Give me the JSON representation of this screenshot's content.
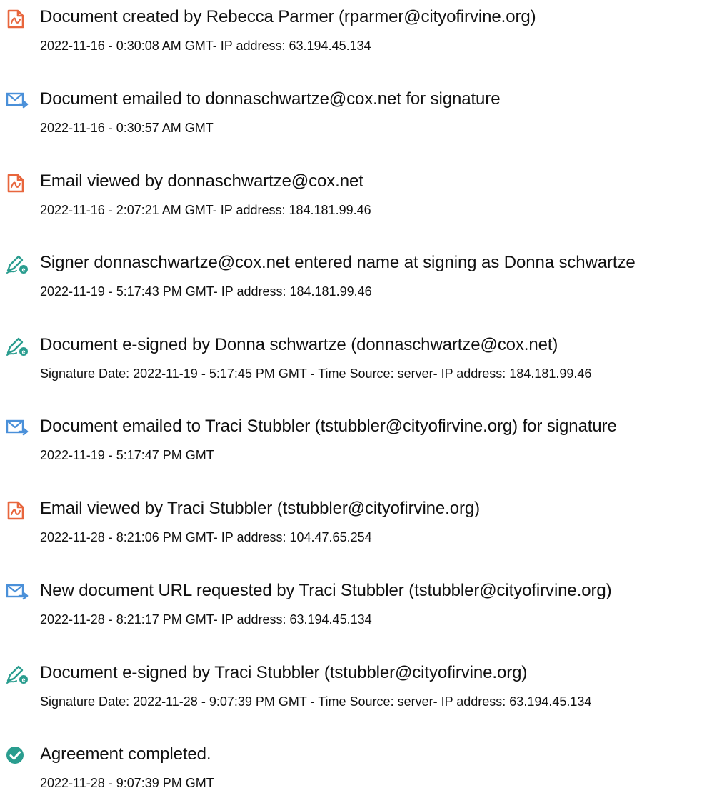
{
  "colors": {
    "doc_icon": "#e8663d",
    "mail_icon": "#4a90d9",
    "sign_icon": "#2a9d8f",
    "check_icon": "#2a9d8f"
  },
  "events": [
    {
      "icon": "document-icon",
      "title": "Document created by Rebecca Parmer (rparmer@cityofirvine.org)",
      "detail": "2022-11-16 - 0:30:08 AM GMT- IP address: 63.194.45.134"
    },
    {
      "icon": "email-icon",
      "title": "Document emailed to donnaschwartze@cox.net for signature",
      "detail": "2022-11-16 - 0:30:57 AM GMT"
    },
    {
      "icon": "document-icon",
      "title": "Email viewed by donnaschwartze@cox.net",
      "detail": "2022-11-16 - 2:07:21 AM GMT- IP address: 184.181.99.46"
    },
    {
      "icon": "esign-icon",
      "title": "Signer donnaschwartze@cox.net entered name at signing as Donna schwartze",
      "detail": "2022-11-19 - 5:17:43 PM GMT- IP address: 184.181.99.46"
    },
    {
      "icon": "esign-icon",
      "title": "Document e-signed by Donna schwartze (donnaschwartze@cox.net)",
      "detail": "Signature Date: 2022-11-19 - 5:17:45 PM GMT - Time Source: server- IP address: 184.181.99.46"
    },
    {
      "icon": "email-icon",
      "title": "Document emailed to Traci Stubbler (tstubbler@cityofirvine.org) for signature",
      "detail": "2022-11-19 - 5:17:47 PM GMT"
    },
    {
      "icon": "document-icon",
      "title": "Email viewed by Traci Stubbler (tstubbler@cityofirvine.org)",
      "detail": "2022-11-28 - 8:21:06 PM GMT- IP address: 104.47.65.254"
    },
    {
      "icon": "email-icon",
      "title": "New document URL requested by Traci Stubbler (tstubbler@cityofirvine.org)",
      "detail": "2022-11-28 - 8:21:17 PM GMT- IP address: 63.194.45.134"
    },
    {
      "icon": "esign-icon",
      "title": "Document e-signed by Traci Stubbler (tstubbler@cityofirvine.org)",
      "detail": "Signature Date: 2022-11-28 - 9:07:39 PM GMT - Time Source: server- IP address: 63.194.45.134"
    },
    {
      "icon": "check-icon",
      "title": "Agreement completed.",
      "detail": "2022-11-28 - 9:07:39 PM GMT"
    }
  ]
}
